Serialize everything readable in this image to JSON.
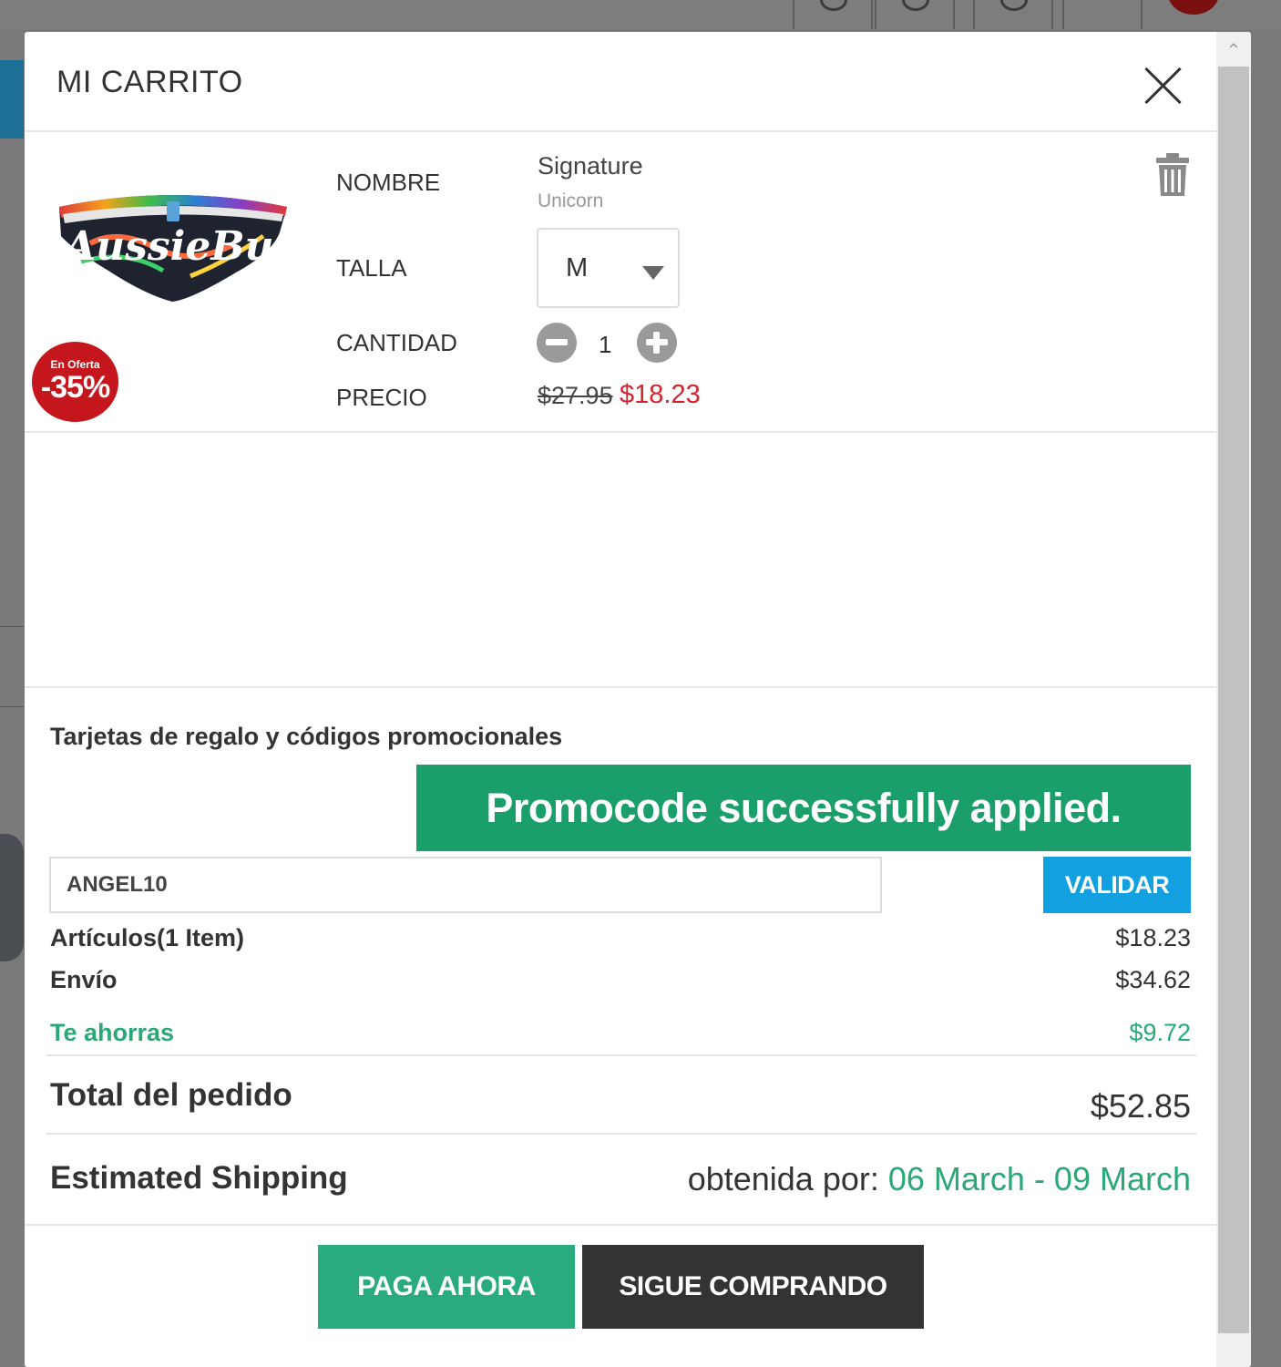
{
  "cart": {
    "title": "MI CARRITO"
  },
  "product": {
    "labels": {
      "name": "NOMBRE",
      "size": "TALLA",
      "quantity": "CANTIDAD",
      "price": "PRECIO"
    },
    "name": "Signature",
    "variant": "Unicorn",
    "size": "M",
    "quantity": "1",
    "old_price": "$27.95",
    "new_price": "$18.23",
    "badge": {
      "label": "En Oferta",
      "discount": "-35%"
    },
    "image_text": "AussieBum"
  },
  "promo": {
    "title": "Tarjetas de regalo y códigos promocionales",
    "success_message": "Promocode successfully applied.",
    "code_value": "ANGEL10",
    "validate_label": "VALIDAR"
  },
  "summary": {
    "items_label": "Artículos(1 Item)",
    "items_value": "$18.23",
    "shipping_label": "Envío",
    "shipping_value": "$34.62",
    "savings_label": "Te ahorras",
    "savings_value": "$9.72",
    "total_label": "Total del pedido",
    "total_value": "$52.85",
    "estimated_label": "Estimated Shipping",
    "obtained_prefix": "obtenida por: ",
    "date_range": "06 March - 09 March"
  },
  "actions": {
    "pay_now": "PAGA AHORA",
    "continue_shopping": "SIGUE COMPRANDO"
  },
  "colors": {
    "accent_green": "#1a9e6a",
    "sale_red": "#c4161c",
    "price_red": "#d0262e",
    "validate_blue": "#12a0e0",
    "dark_button": "#333333"
  }
}
